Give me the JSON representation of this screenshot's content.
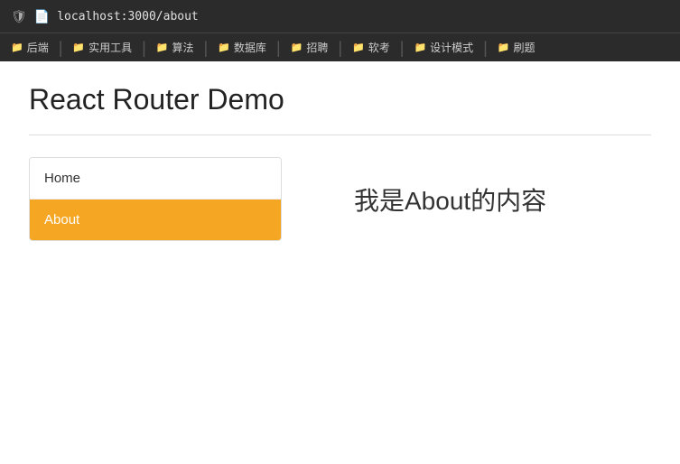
{
  "browser": {
    "url": "localhost:3000/about"
  },
  "bookmarks": [
    {
      "id": "b1",
      "label": "后端",
      "icon": "folder"
    },
    {
      "id": "b2",
      "label": "实用工具",
      "icon": "folder"
    },
    {
      "id": "b3",
      "label": "算法",
      "icon": "folder"
    },
    {
      "id": "b4",
      "label": "数据库",
      "icon": "folder"
    },
    {
      "id": "b5",
      "label": "招聘",
      "icon": "folder"
    },
    {
      "id": "b6",
      "label": "软考",
      "icon": "folder"
    },
    {
      "id": "b7",
      "label": "设计模式",
      "icon": "folder"
    },
    {
      "id": "b8",
      "label": "刷题",
      "icon": "folder"
    }
  ],
  "app": {
    "title": "React Router Demo",
    "nav_items": [
      {
        "id": "home",
        "label": "Home",
        "active": false
      },
      {
        "id": "about",
        "label": "About",
        "active": true
      }
    ],
    "content": "我是About的内容",
    "colors": {
      "active_bg": "#f5a623",
      "active_text": "#ffffff"
    }
  }
}
